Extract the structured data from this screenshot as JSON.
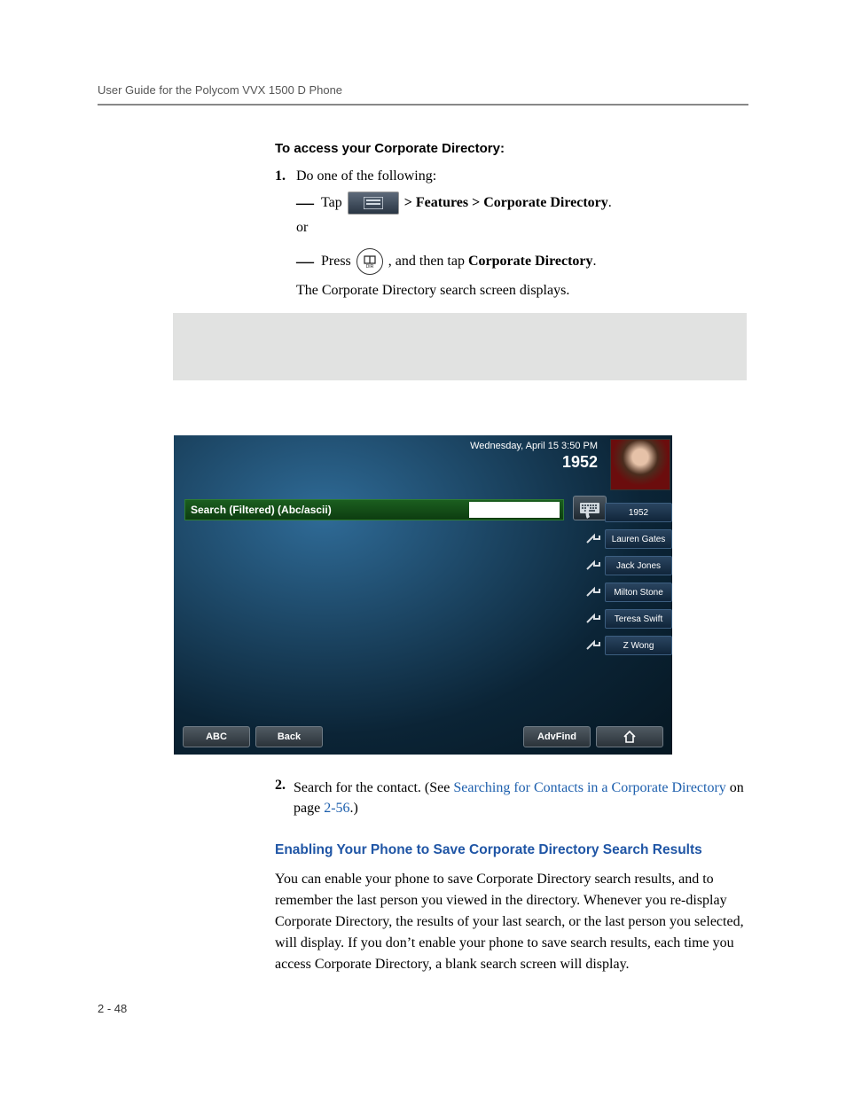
{
  "header": {
    "running_head": "User Guide for the Polycom VVX 1500 D Phone"
  },
  "section": {
    "title": "To access your Corporate Directory:",
    "step1_num": "1.",
    "step1_text": "Do one of the following:",
    "opt_a_prefix": "Tap",
    "opt_a_suffix_bold": " > Features > Corporate Directory",
    "opt_a_period": ".",
    "or_text": "or",
    "opt_b_prefix": "Press",
    "opt_b_mid": ", and then tap ",
    "opt_b_bold": "Corporate Directory",
    "opt_b_period": ".",
    "after_para": "The Corporate Directory search screen displays."
  },
  "phone": {
    "date": "Wednesday, April 15  3:50 PM",
    "extension": "1952",
    "search_label": "Search (Filtered) (Abc/ascii)",
    "sidekeys": [
      "1952",
      "Lauren Gates",
      "Jack Jones",
      "Milton Stone",
      "Teresa Swift",
      "Z Wong"
    ],
    "softkeys": {
      "abc": "ABC",
      "back": "Back",
      "advfind": "AdvFind"
    }
  },
  "section2": {
    "step2_num": "2.",
    "step2_text_a": "Search for the contact. (See ",
    "step2_link": "Searching for Contacts in a Corporate Directory",
    "step2_text_b": " on page ",
    "step2_pageref": "2-56",
    "step2_text_c": ".)",
    "subhead": "Enabling Your Phone to Save Corporate Directory Search Results",
    "body": "You can enable your phone to save Corporate Directory search results, and to remember the last person you viewed in the directory. Whenever you re-display Corporate Directory, the results of your last search, or the last person you selected, will display. If you don’t enable your phone to save search results, each time you access Corporate Directory, a blank search screen will display."
  },
  "footer": {
    "page_num": "2 - 48"
  }
}
